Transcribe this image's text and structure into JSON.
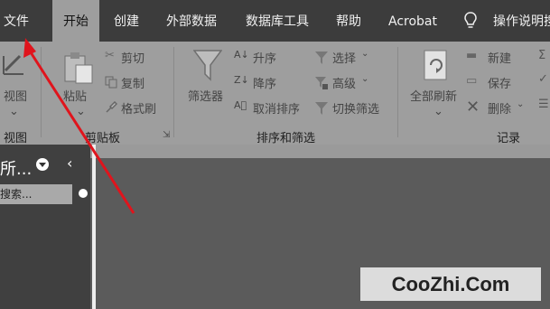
{
  "menubar": {
    "tabs": [
      {
        "label": "文件"
      },
      {
        "label": "开始"
      },
      {
        "label": "创建"
      },
      {
        "label": "外部数据"
      },
      {
        "label": "数据库工具"
      },
      {
        "label": "帮助"
      },
      {
        "label": "Acrobat"
      }
    ],
    "active_tab": "开始",
    "tell_me": "操作说明搜"
  },
  "ribbon": {
    "view_group": {
      "button_label": "视图",
      "group_label": "视图"
    },
    "clipboard": {
      "paste_label": "粘贴",
      "cut_label": "剪切",
      "copy_label": "复制",
      "format_painter_label": "格式刷",
      "group_label": "剪贴板"
    },
    "sort_filter": {
      "filter_label": "筛选器",
      "ascending_label": "升序",
      "descending_label": "降序",
      "remove_sort_label": "取消排序",
      "selection_label": "选择",
      "advanced_label": "高级",
      "toggle_filter_label": "切换筛选",
      "group_label": "排序和筛选"
    },
    "records": {
      "refresh_all_label": "全部刷新",
      "new_label": "新建",
      "save_label": "保存",
      "delete_label": "删除",
      "group_label": "记录"
    }
  },
  "nav_pane": {
    "title": "所...",
    "search_placeholder": "搜索..."
  },
  "watermark": "CooZhi.Com",
  "colors": {
    "menubar_bg": "#3c3c3c",
    "ribbon_bg": "#9e9e9e",
    "annotation_arrow": "#e0141c"
  }
}
